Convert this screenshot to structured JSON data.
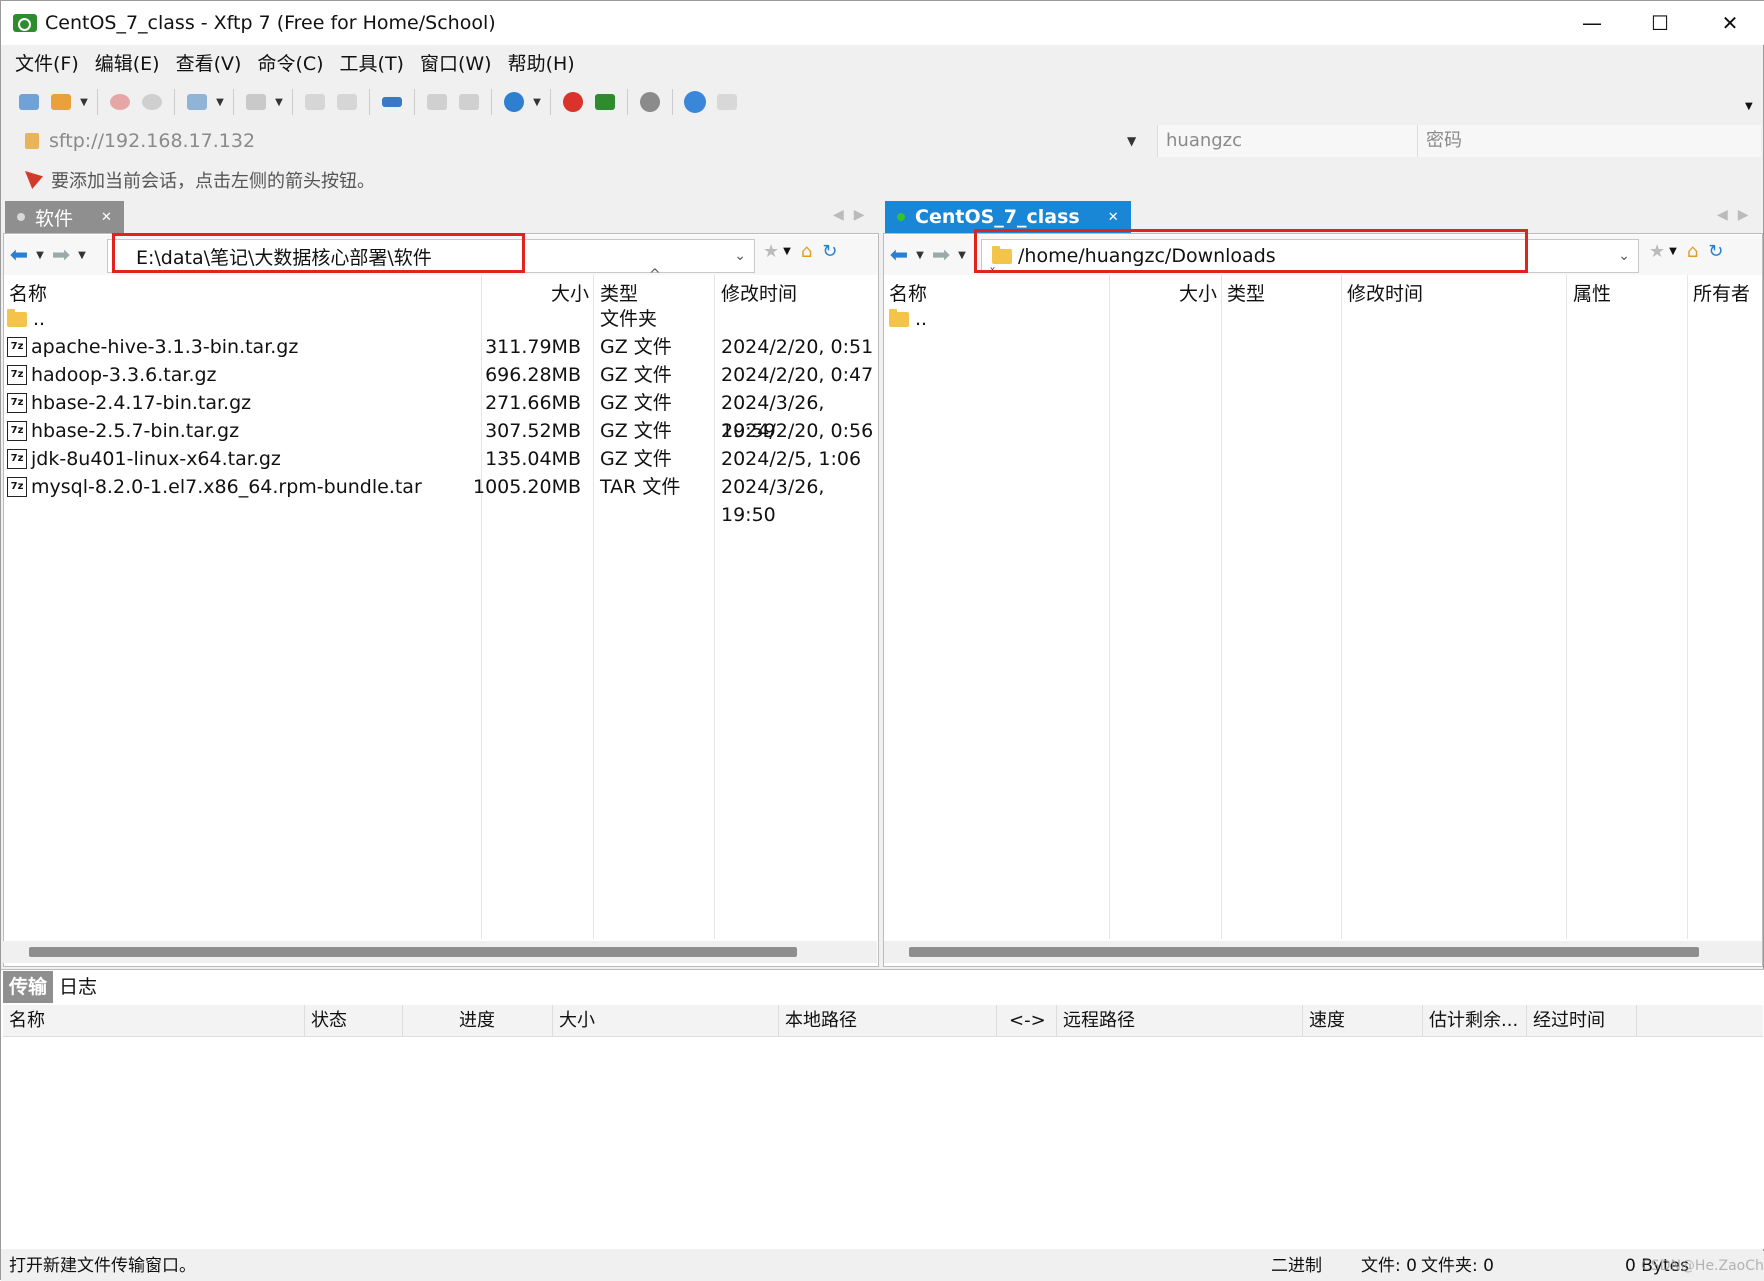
{
  "window": {
    "title": "CentOS_7_class - Xftp 7 (Free for Home/School)",
    "minimize": "—",
    "maximize": "☐",
    "close": "✕"
  },
  "menu": [
    "文件(F)",
    "编辑(E)",
    "查看(V)",
    "命令(C)",
    "工具(T)",
    "窗口(W)",
    "帮助(H)"
  ],
  "address": {
    "url": "sftp://192.168.17.132",
    "user_placeholder": "huangzc",
    "password_placeholder": "密码"
  },
  "hint": "要添加当前会话，点击左侧的箭头按钮。",
  "left_pane": {
    "tab_label": "软件",
    "path": "E:\\data\\笔记\\大数据核心部署\\软件",
    "columns": [
      "名称",
      "大小",
      "类型",
      "修改时间"
    ],
    "rows": [
      {
        "name": "..",
        "size": "",
        "type": "文件夹",
        "modified": "",
        "kind": "folder"
      },
      {
        "name": "apache-hive-3.1.3-bin.tar.gz",
        "size": "311.79MB",
        "type": "GZ 文件",
        "modified": "2024/2/20, 0:51",
        "kind": "archive"
      },
      {
        "name": "hadoop-3.3.6.tar.gz",
        "size": "696.28MB",
        "type": "GZ 文件",
        "modified": "2024/2/20, 0:47",
        "kind": "archive"
      },
      {
        "name": "hbase-2.4.17-bin.tar.gz",
        "size": "271.66MB",
        "type": "GZ 文件",
        "modified": "2024/3/26, 19:59",
        "kind": "archive"
      },
      {
        "name": "hbase-2.5.7-bin.tar.gz",
        "size": "307.52MB",
        "type": "GZ 文件",
        "modified": "2024/2/20, 0:56",
        "kind": "archive"
      },
      {
        "name": "jdk-8u401-linux-x64.tar.gz",
        "size": "135.04MB",
        "type": "GZ 文件",
        "modified": "2024/2/5, 1:06",
        "kind": "archive"
      },
      {
        "name": "mysql-8.2.0-1.el7.x86_64.rpm-bundle.tar",
        "size": "1005.20MB",
        "type": "TAR 文件",
        "modified": "2024/3/26, 19:50",
        "kind": "archive"
      }
    ]
  },
  "right_pane": {
    "tab_label": "CentOS_7_class",
    "path": "/home/huangzc/Downloads",
    "columns": [
      "名称",
      "大小",
      "类型",
      "修改时间",
      "属性",
      "所有者"
    ],
    "rows": [
      {
        "name": "..",
        "kind": "folder"
      }
    ]
  },
  "transfer": {
    "tabs": [
      "传输",
      "日志"
    ],
    "columns": [
      "名称",
      "状态",
      "进度",
      "大小",
      "本地路径",
      "<->",
      "远程路径",
      "速度",
      "估计剩余...",
      "经过时间"
    ]
  },
  "statusbar": {
    "message": "打开新建文件传输窗口。",
    "mode": "二进制",
    "files": "文件: 0",
    "folders": "文件夹: 0",
    "bytes": "0 Bytes",
    "watermark": "CSDN@He.ZaoCha"
  },
  "colors": {
    "accent": "#1a87d6",
    "highlight_box": "#e0231b",
    "folder": "#f3c34a"
  }
}
